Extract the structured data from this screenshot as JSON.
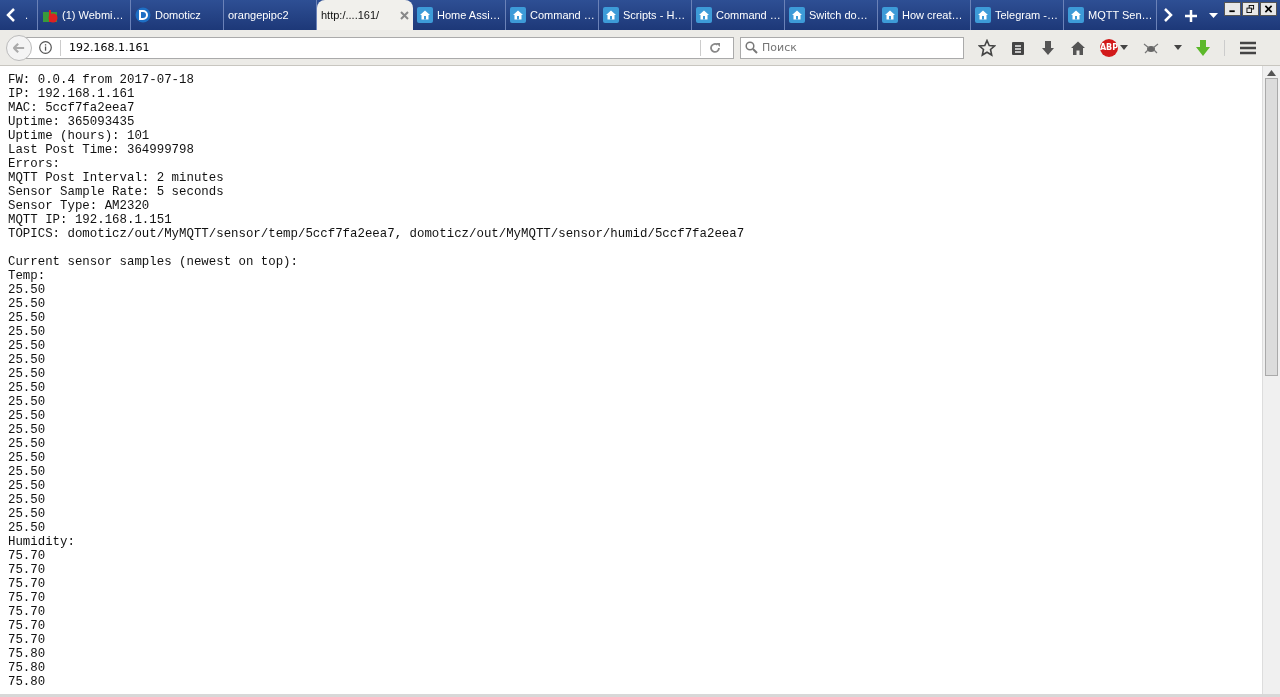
{
  "tabs": [
    {
      "label": ".",
      "kind": "partial",
      "selected": false
    },
    {
      "label": "(1) Webmi…",
      "kind": "gift",
      "selected": false
    },
    {
      "label": "Domoticz",
      "kind": "domoticz",
      "selected": false
    },
    {
      "label": "orangepipc2",
      "kind": "plain",
      "selected": false
    },
    {
      "label": "http:/....161/",
      "kind": "plain",
      "selected": true
    },
    {
      "label": "Home Assi…",
      "kind": "house",
      "selected": false
    },
    {
      "label": "Command …",
      "kind": "house",
      "selected": false
    },
    {
      "label": "Scripts - H…",
      "kind": "house",
      "selected": false
    },
    {
      "label": "Command …",
      "kind": "house",
      "selected": false
    },
    {
      "label": "Switch do…",
      "kind": "house",
      "selected": false
    },
    {
      "label": "How creat…",
      "kind": "house",
      "selected": false
    },
    {
      "label": "Telegram -…",
      "kind": "house",
      "selected": false
    },
    {
      "label": "MQTT Sen…",
      "kind": "house",
      "selected": false
    }
  ],
  "address_bar": {
    "value": "192.168.1.161"
  },
  "search": {
    "placeholder": "Поиск"
  },
  "adblock_badge": "ABP",
  "sections": [
    {
      "lines": [
        "FW: 0.0.4 from 2017-07-18",
        "IP: 192.168.1.161",
        "MAC: 5ccf7fa2eea7",
        "Uptime: 365093435",
        "Uptime (hours): 101",
        "Last Post Time: 364999798",
        "Errors:",
        "MQTT Post Interval: 2 minutes",
        "Sensor Sample Rate: 5 seconds",
        "Sensor Type: AM2320",
        "MQTT IP: 192.168.1.151",
        "TOPICS: domoticz/out/MyMQTT/sensor/temp/5ccf7fa2eea7, domoticz/out/MyMQTT/sensor/humid/5ccf7fa2eea7"
      ]
    },
    {
      "lines": [
        "Current sensor samples (newest on top):",
        "Temp:",
        "25.50",
        "25.50",
        "25.50",
        "25.50",
        "25.50",
        "25.50",
        "25.50",
        "25.50",
        "25.50",
        "25.50",
        "25.50",
        "25.50",
        "25.50",
        "25.50",
        "25.50",
        "25.50",
        "25.50",
        "25.50",
        "Humidity:",
        "75.70",
        "75.70",
        "75.70",
        "75.70",
        "75.70",
        "75.70",
        "75.70",
        "75.80",
        "75.80",
        "75.80"
      ]
    }
  ]
}
